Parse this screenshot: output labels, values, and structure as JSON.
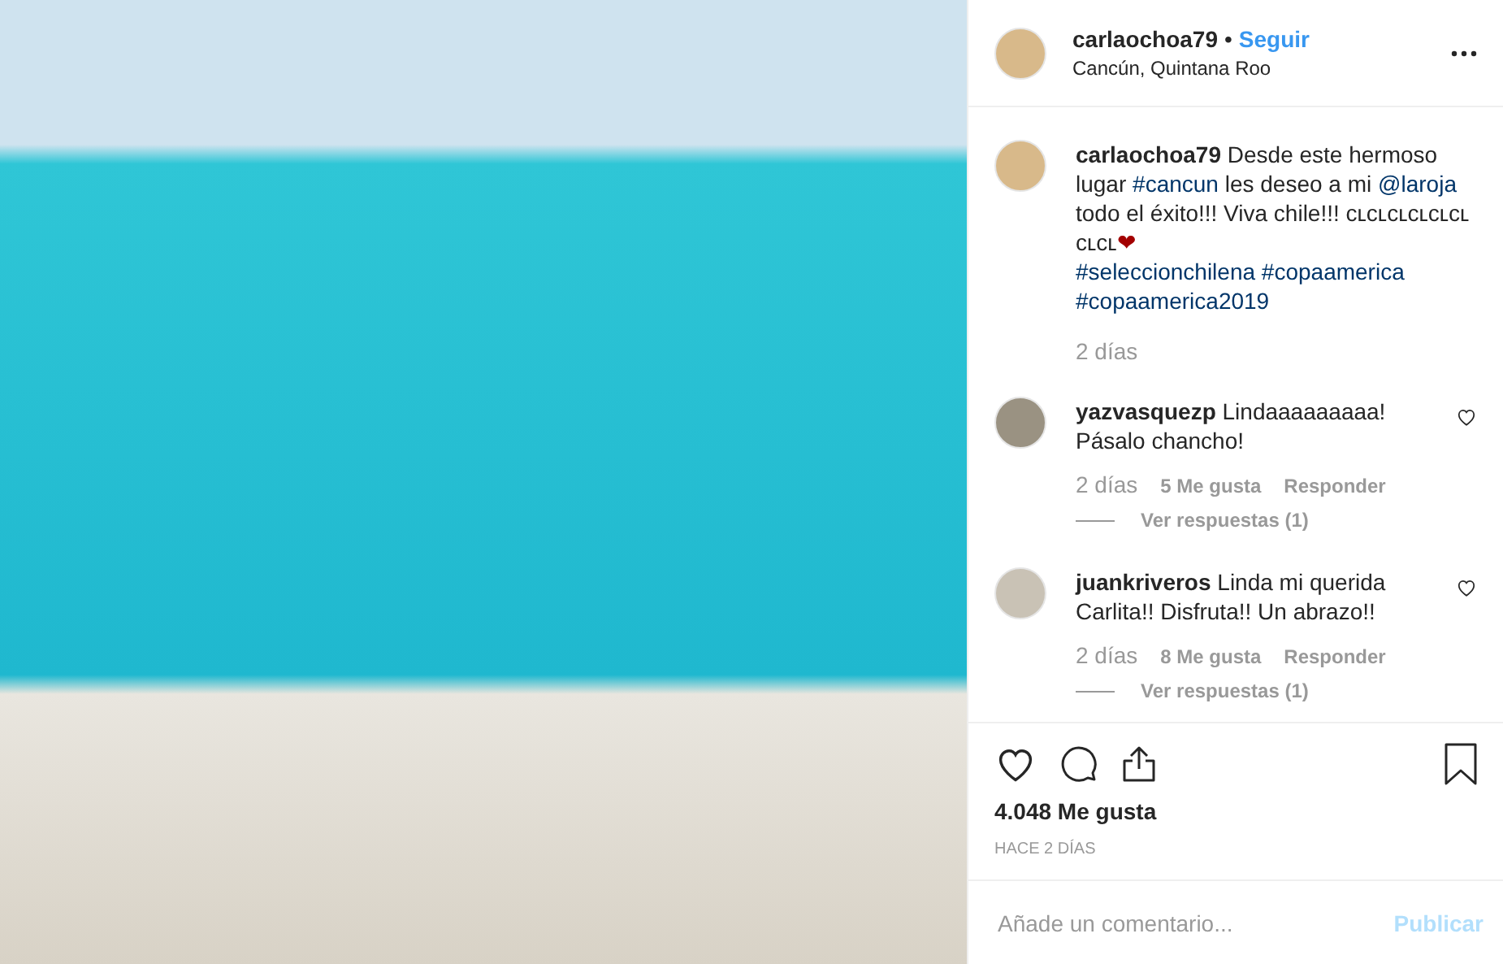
{
  "post": {
    "username": "carlaochoa79",
    "separator": "•",
    "follow_label": "Seguir",
    "location": "Cancún, Quintana Roo"
  },
  "caption": {
    "username": "carlaochoa79",
    "segments": [
      {
        "kind": "text",
        "text": "Desde este hermoso lugar "
      },
      {
        "kind": "link",
        "text": "#cancun"
      },
      {
        "kind": "text",
        "text": " les deseo a mi "
      },
      {
        "kind": "link",
        "text": "@laroja"
      },
      {
        "kind": "text",
        "text": " todo el éxito!!! Viva chile!!! ᴄʟᴄʟᴄʟᴄʟᴄʟᴄʟ ᴄʟᴄʟ"
      },
      {
        "kind": "heart",
        "text": "❤"
      },
      {
        "kind": "break"
      },
      {
        "kind": "link",
        "text": "#seleccionchilena"
      },
      {
        "kind": "link",
        "text": "#copaamerica"
      },
      {
        "kind": "break"
      },
      {
        "kind": "link",
        "text": "#copaamerica2019"
      }
    ],
    "time": "2 días"
  },
  "comments": [
    {
      "username": "yazvasquezp",
      "text": "Lindaaaaaaaaa! Pásalo chancho!",
      "time": "2 días",
      "likes": "5 Me gusta",
      "reply": "Responder",
      "replies": "Ver respuestas (1)",
      "liked": false
    },
    {
      "username": "juankriveros",
      "text": "Linda mi querida Carlita!! Disfruta!! Un abrazo!!",
      "time": "2 días",
      "likes": "8 Me gusta",
      "reply": "Responder",
      "replies": "Ver respuestas (1)",
      "liked": false
    }
  ],
  "likes": "4.048 Me gusta",
  "date": "HACE 2 DÍAS",
  "comment_box": {
    "placeholder": "Añade un comentario...",
    "submit": "Publicar",
    "disabled": true
  }
}
